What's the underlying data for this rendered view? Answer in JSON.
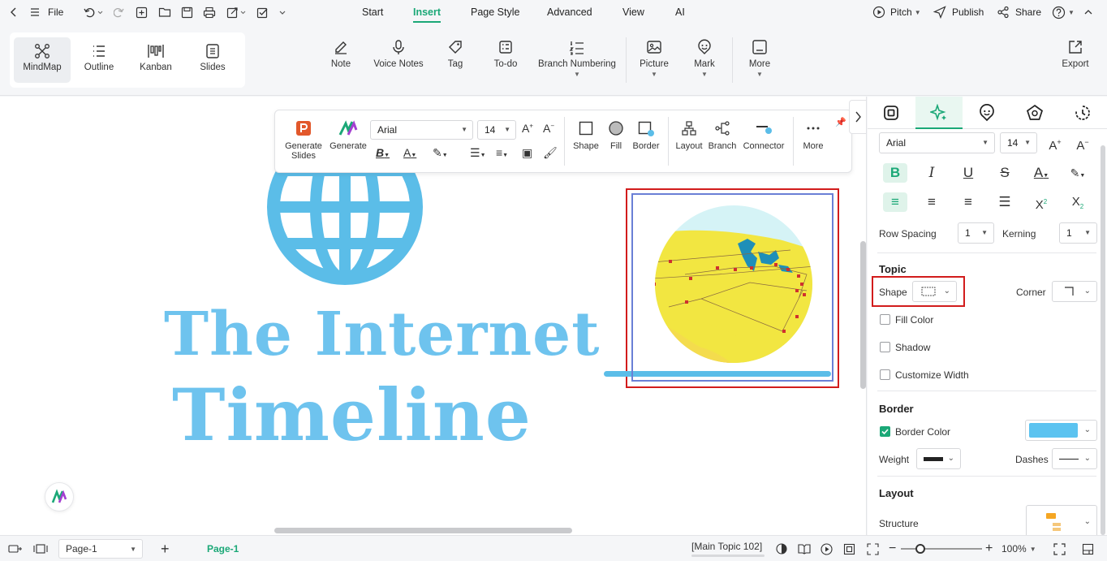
{
  "menubar": {
    "file_label": "File",
    "tabs": [
      "Start",
      "Insert",
      "Page Style",
      "Advanced",
      "View",
      "AI"
    ],
    "active_tab": "Insert",
    "pitch_label": "Pitch",
    "publish_label": "Publish",
    "share_label": "Share"
  },
  "views": [
    "MindMap",
    "Outline",
    "Kanban",
    "Slides"
  ],
  "ribbon": {
    "note": "Note",
    "voice_notes": "Voice Notes",
    "tag": "Tag",
    "todo": "To-do",
    "branch_numbering": "Branch Numbering",
    "picture": "Picture",
    "mark": "Mark",
    "more": "More",
    "export": "Export"
  },
  "floatbar": {
    "generate_slides": "Generate Slides",
    "generate": "Generate",
    "font": "Arial",
    "size": "14",
    "shape": "Shape",
    "fill": "Fill",
    "border": "Border",
    "layout": "Layout",
    "branch": "Branch",
    "connector": "Connector",
    "more": "More"
  },
  "canvas": {
    "title_line1": "The Internet",
    "title_line2": "Timeline"
  },
  "panel": {
    "font": "Arial",
    "size": "14",
    "row_spacing_label": "Row Spacing",
    "row_spacing": "1",
    "kerning_label": "Kerning",
    "kerning": "1",
    "topic_heading": "Topic",
    "shape_label": "Shape",
    "corner_label": "Corner",
    "fill_color": "Fill Color",
    "shadow": "Shadow",
    "customize_width": "Customize Width",
    "border_heading": "Border",
    "border_color": "Border Color",
    "border_color_value": "#5bc3f0",
    "weight_label": "Weight",
    "dashes_label": "Dashes",
    "layout_heading": "Layout",
    "structure_label": "Structure"
  },
  "status": {
    "page_select": "Page-1",
    "page_tab": "Page-1",
    "selection": "[Main Topic 102]",
    "zoom": "100%"
  },
  "colors": {
    "accent": "#1ba877",
    "highlight": "#d21c1c",
    "title": "#6ec3ee"
  }
}
